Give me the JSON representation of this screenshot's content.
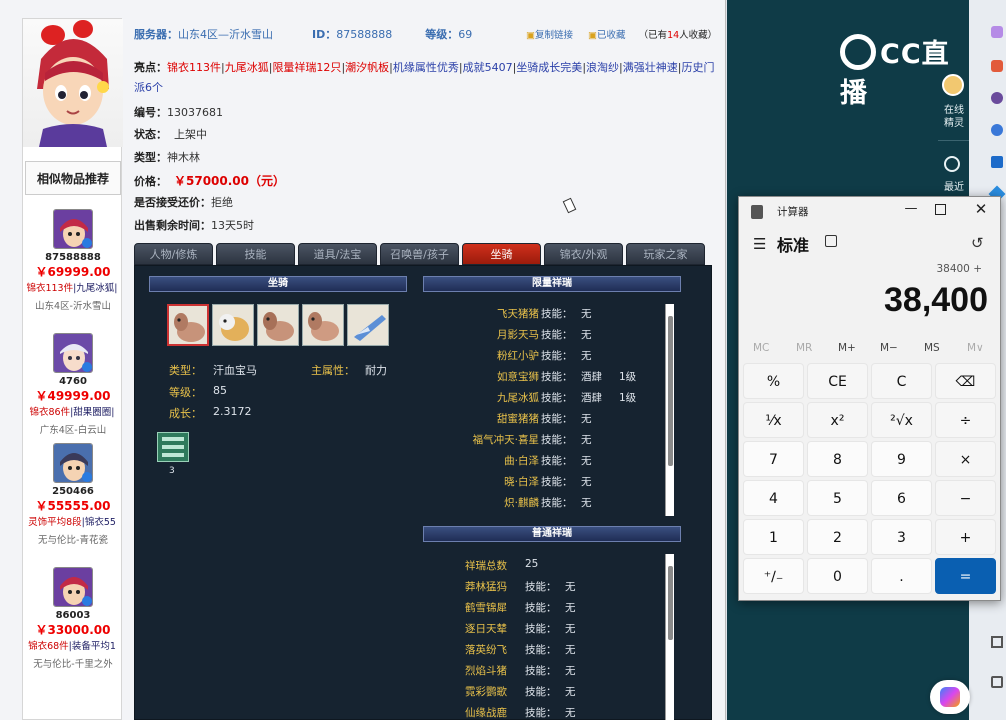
{
  "item": {
    "server_label": "服务器：",
    "server": "山东4区—沂水雪山",
    "id_label": "ID：",
    "id": "87588888",
    "level_label": "等级：",
    "level": "69",
    "copy_link": "复制链接",
    "favorited": "已收藏",
    "fav_count_pre": "（已有",
    "fav_count": "14",
    "fav_count_post": "人收藏）",
    "highlights_label": "亮点：",
    "highlights": [
      "锦衣113件",
      "九尾冰狐",
      "限量祥瑞12只",
      "潮汐帆板",
      "机缘属性优秀",
      "成就5407",
      "坐骑成长完美",
      "浪淘纱",
      "满强壮神速",
      "历史门派6个"
    ],
    "number_label": "编号：",
    "number": "13037681",
    "status_label": "状态：",
    "status": "上架中",
    "type_label": "类型：",
    "type": "神木林",
    "price_label": "价格：",
    "price": "￥57000.00（元）",
    "counter_label": "是否接受还价：",
    "counter": "拒绝",
    "remaining_label": "出售剩余时间：",
    "remaining": "13天5时"
  },
  "similar": {
    "title": "相似物品推荐",
    "items": [
      {
        "id": "87588888",
        "price": "￥69999.00",
        "tag": "锦衣113件",
        "tag2": "|九尾冰狐|",
        "server": "山东4区-沂水雪山"
      },
      {
        "id": "4760",
        "price": "￥49999.00",
        "tag": "锦衣86件",
        "tag2": "|甜果圈圈|",
        "server": "广东4区-白云山"
      },
      {
        "id": "250466",
        "price": "￥55555.00",
        "tag": "灵饰平均8段",
        "tag2": "|锦衣55",
        "server": "无与伦比-青花瓷"
      },
      {
        "id": "86003",
        "price": "￥33000.00",
        "tag": "锦衣68件",
        "tag2": "|装备平均1",
        "server": "无与伦比-千里之外"
      }
    ]
  },
  "tabs": [
    "人物/修炼",
    "技能",
    "道具/法宝",
    "召唤兽/孩子",
    "坐骑",
    "锦衣/外观",
    "玩家之家"
  ],
  "mount_panel": {
    "header": "坐骑",
    "type_label": "类型：",
    "type": "汗血宝马",
    "main_attr_label": "主属性：",
    "main_attr": "耐力",
    "level_label": "等级：",
    "level": "85",
    "growth_label": "成长：",
    "growth": "2.3172",
    "item_count": "3"
  },
  "limited_panel": {
    "header": "限量祥瑞",
    "skill_label": "技能：",
    "items": [
      {
        "name": "飞天猪猪",
        "skill": "无",
        "lv": ""
      },
      {
        "name": "月影天马",
        "skill": "无",
        "lv": ""
      },
      {
        "name": "粉红小驴",
        "skill": "无",
        "lv": ""
      },
      {
        "name": "如意宝狮",
        "skill": "酒肆",
        "lv": "1级"
      },
      {
        "name": "九尾冰狐",
        "skill": "酒肆",
        "lv": "1级"
      },
      {
        "name": "甜蜜猪猪",
        "skill": "无",
        "lv": ""
      },
      {
        "name": "福气冲天·喜星",
        "skill": "无",
        "lv": ""
      },
      {
        "name": "曲·白泽",
        "skill": "无",
        "lv": ""
      },
      {
        "name": "晓·白泽",
        "skill": "无",
        "lv": ""
      },
      {
        "name": "炽·麒麟",
        "skill": "无",
        "lv": ""
      }
    ]
  },
  "normal_panel": {
    "header": "普通祥瑞",
    "total_label": "祥瑞总数",
    "total": "25",
    "skill_label": "技能：",
    "items": [
      {
        "name": "莽林猛犸",
        "skill": "无"
      },
      {
        "name": "鹤雪锦犀",
        "skill": "无"
      },
      {
        "name": "逐日天辇",
        "skill": "无"
      },
      {
        "name": "落英纷飞",
        "skill": "无"
      },
      {
        "name": "烈焰斗猪",
        "skill": "无"
      },
      {
        "name": "霓彩鹦歌",
        "skill": "无"
      },
      {
        "name": "仙缘战鹿",
        "skill": "无"
      }
    ]
  },
  "cc": {
    "logo": "CC直播",
    "online_label": "在线精灵",
    "recent_label": "最近"
  },
  "calculator": {
    "title": "计算器",
    "mode": "标准",
    "expression": "38400 +",
    "display": "38,400",
    "memory": [
      "MC",
      "MR",
      "M+",
      "M−",
      "MS",
      "M∨"
    ],
    "keys": [
      [
        "%",
        "CE",
        "C",
        "⌫"
      ],
      [
        "¹⁄x",
        "x²",
        "²√x",
        "÷"
      ],
      [
        "7",
        "8",
        "9",
        "×"
      ],
      [
        "4",
        "5",
        "6",
        "−"
      ],
      [
        "1",
        "2",
        "3",
        "+"
      ],
      [
        "⁺∕₋",
        "0",
        ".",
        "="
      ]
    ]
  }
}
